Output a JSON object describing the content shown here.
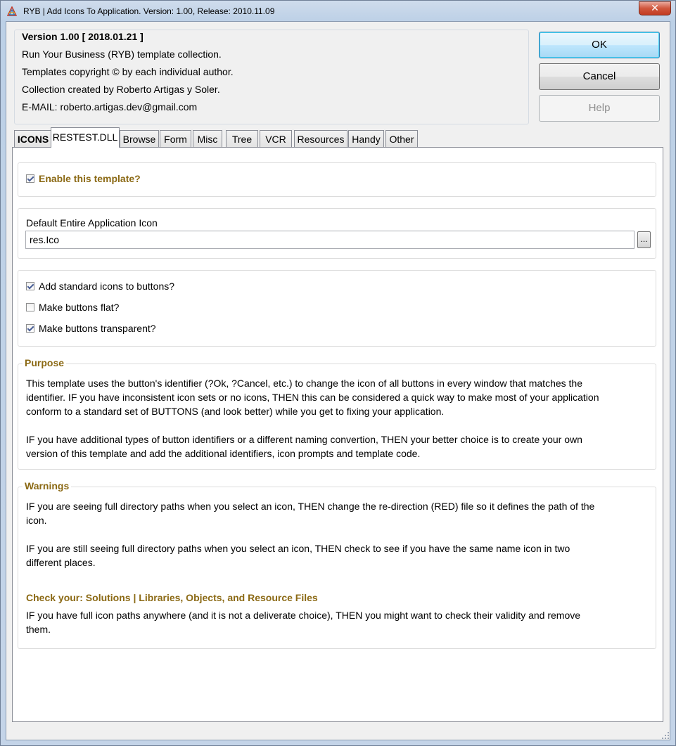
{
  "window": {
    "title": "RYB | Add Icons To Application. Version: 1.00, Release: 2010.11.09",
    "close_glyph": "✕"
  },
  "info": {
    "version": "Version 1.00 [ 2018.01.21 ]",
    "line1": "Run Your Business (RYB) template collection.",
    "line2": "Templates copyright © by each individual author.",
    "line3": "Collection created by Roberto Artigas y Soler.",
    "line4": "E-MAIL: roberto.artigas.dev@gmail.com"
  },
  "buttons": {
    "ok": "OK",
    "cancel": "Cancel",
    "help": "Help"
  },
  "tabs": [
    "ICONS",
    "RESTEST.DLL",
    "Browse",
    "Form",
    "Misc",
    "Tree",
    "VCR",
    "Resources",
    "Handy",
    "Other"
  ],
  "active_tab": "RESTEST.DLL",
  "enable": {
    "label": "Enable this template?",
    "checked": true
  },
  "icon_group": {
    "label": "Default Entire Application Icon",
    "value": "res.Ico",
    "browse": "..."
  },
  "options": [
    {
      "label": "Add standard icons to buttons?",
      "checked": true
    },
    {
      "label": "Make buttons flat?",
      "checked": false
    },
    {
      "label": "Make buttons transparent?",
      "checked": true
    }
  ],
  "purpose": {
    "title": "Purpose",
    "p1_l1": "This template uses the button's identifier (?Ok, ?Cancel, etc.) to change the icon of all buttons in every window that matches the",
    "p1_l2": "identifier. IF you have inconsistent icon sets or no icons, THEN this can be considered a quick way to make most of your application",
    "p1_l3": "conform to a standard set of BUTTONS (and look better) while you get to fixing your application.",
    "p2_l1": "IF you have additional types of button identifiers or a different naming convertion, THEN your better choice is to create your own",
    "p2_l2": "version of this template and add the additional identifiers, icon prompts and template code."
  },
  "warnings": {
    "title": "Warnings",
    "p1_l1": "IF you are seeing full directory paths when you select an icon, THEN change the re-direction (RED) file so it defines the path of the",
    "p1_l2": "icon.",
    "p2_l1": "IF you are still seeing full directory paths when you select an icon, THEN check to see if you have the same name icon in two",
    "p2_l2": "different places.",
    "check_heading": "Check your: Solutions | Libraries, Objects, and Resource Files",
    "p3_l1": "IF you have full icon paths anywhere (and it is not a deliverate choice), THEN you might want to check their validity and remove",
    "p3_l2": "them."
  }
}
